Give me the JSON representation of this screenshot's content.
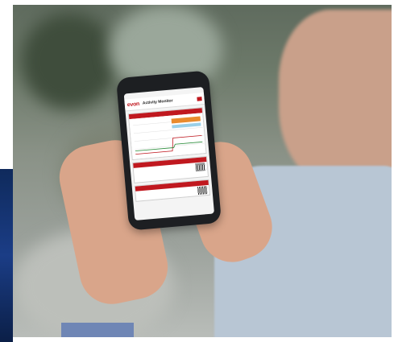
{
  "phone": {
    "app_title": "Activity Monitor",
    "logo_text": "evon"
  },
  "colors": {
    "brand_red": "#c0181f"
  }
}
